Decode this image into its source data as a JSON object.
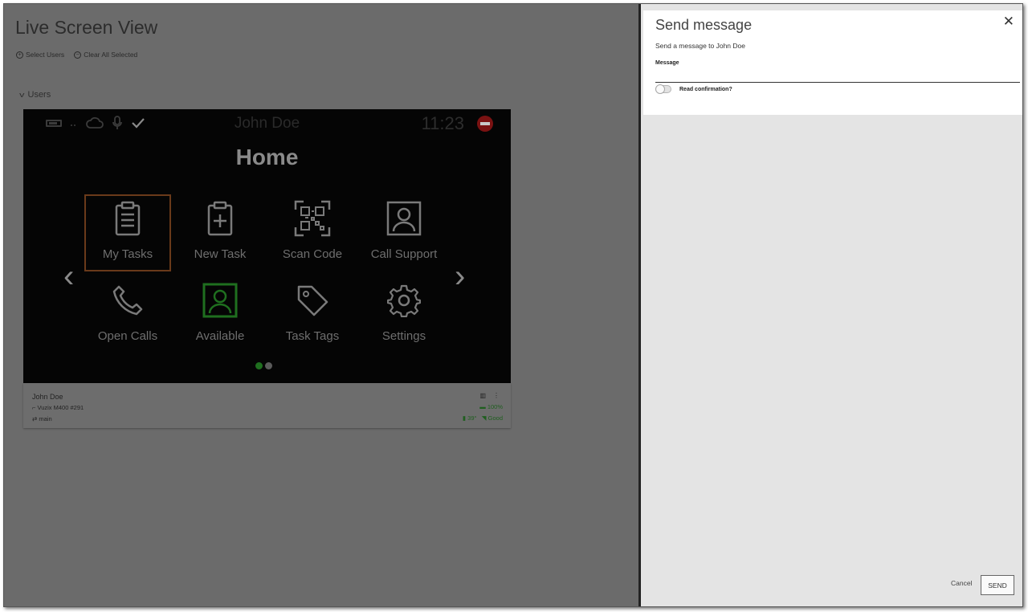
{
  "page": {
    "title": "Live Screen View",
    "select_users": "Select Users",
    "clear_all_selected": "Clear All Selected",
    "users_section": "Users"
  },
  "device_screen": {
    "user_name": "John Doe",
    "time": "11:23",
    "home_title": "Home",
    "tiles": [
      {
        "label": "My Tasks",
        "icon": "clipboard-icon"
      },
      {
        "label": "New Task",
        "icon": "clipboard-plus-icon"
      },
      {
        "label": "Scan Code",
        "icon": "qr-code-icon"
      },
      {
        "label": "Call Support",
        "icon": "contact-icon"
      },
      {
        "label": "Open Calls",
        "icon": "phone-icon"
      },
      {
        "label": "Available",
        "icon": "person-icon"
      },
      {
        "label": "Task Tags",
        "icon": "tag-icon"
      },
      {
        "label": "Settings",
        "icon": "gear-icon"
      }
    ],
    "active_tile": "My Tasks",
    "active_page_index": 0
  },
  "user_card": {
    "name": "John Doe",
    "device": "Vuzix M400 #291",
    "branch": "main",
    "battery": "100%",
    "signal": "Good",
    "temperature": "39°",
    "status_color": "#1f6f1f"
  },
  "panel": {
    "title": "Send message",
    "subtitle": "Send a message to John Doe",
    "message_label": "Message",
    "message_value": "",
    "read_confirmation_label": "Read confirmation?",
    "read_confirmation_checked": false,
    "cancel_label": "Cancel",
    "send_label": "SEND"
  }
}
